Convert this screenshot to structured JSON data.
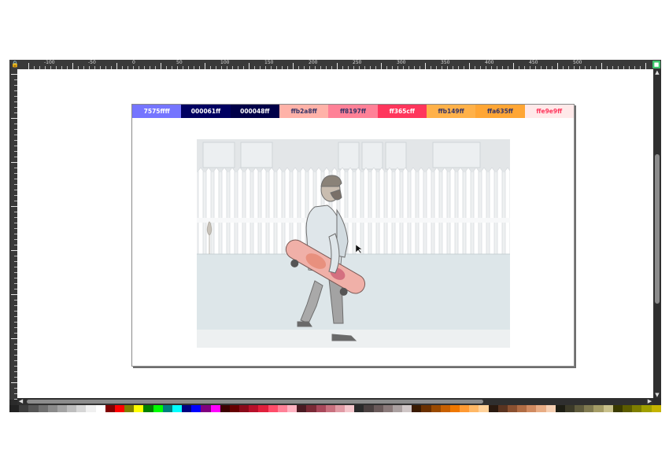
{
  "ruler": {
    "labels": [
      "-100",
      "-50",
      "0",
      "50",
      "100",
      "150",
      "200",
      "250",
      "300",
      "350",
      "400",
      "450",
      "500"
    ]
  },
  "palette": [
    {
      "label": "7575ffff",
      "bg": "#7575ff",
      "fg": "#ffffff"
    },
    {
      "label": "000061ff",
      "bg": "#000061",
      "fg": "#ffffff"
    },
    {
      "label": "000048ff",
      "bg": "#000048",
      "fg": "#ffffff"
    },
    {
      "label": "ffb2a8ff",
      "bg": "#ffb2a8",
      "fg": "#333366"
    },
    {
      "label": "ff8197ff",
      "bg": "#ff8197",
      "fg": "#333366"
    },
    {
      "label": "ff365cff",
      "bg": "#ff365c",
      "fg": "#ffffff"
    },
    {
      "label": "ffb149ff",
      "bg": "#ffb149",
      "fg": "#333366"
    },
    {
      "label": "ffa635ff",
      "bg": "#ffa635",
      "fg": "#333366"
    },
    {
      "label": "ffe9e9ff",
      "bg": "#ffe9e9",
      "fg": "#ff365c"
    }
  ],
  "colorbar": [
    "#222222",
    "#3d3d3d",
    "#555555",
    "#6f6f6f",
    "#8a8a8a",
    "#a3a3a3",
    "#bdbdbd",
    "#d6d6d6",
    "#f0f0f0",
    "#ffffff",
    "#800000",
    "#ff0000",
    "#808000",
    "#ffff00",
    "#008000",
    "#00ff00",
    "#008080",
    "#00ffff",
    "#000080",
    "#0000ff",
    "#800080",
    "#ff00ff",
    "#3d0000",
    "#660000",
    "#8a0a1a",
    "#b8102a",
    "#e0203c",
    "#ff4d6a",
    "#ff8197",
    "#ffb2c1",
    "#4a1a22",
    "#7a2a36",
    "#a8485a",
    "#c8707e",
    "#e09aa4",
    "#f4c6cc",
    "#2a2a2a",
    "#4a4040",
    "#6a5a5a",
    "#8a7a7a",
    "#aaa0a0",
    "#cfc6c6",
    "#3a1a00",
    "#6a3000",
    "#9a4a00",
    "#c86000",
    "#f07800",
    "#ff9a33",
    "#ffb866",
    "#ffd199",
    "#2a1a10",
    "#5a3420",
    "#8a5030",
    "#b06c44",
    "#d08a60",
    "#e8ac84",
    "#f6cfb2",
    "#1e1e14",
    "#3c3a28",
    "#5e5a3c",
    "#807a50",
    "#a49c66",
    "#c8c08a",
    "#3a3a00",
    "#5c5c00",
    "#7e7e00",
    "#a0a000",
    "#c4b400"
  ]
}
